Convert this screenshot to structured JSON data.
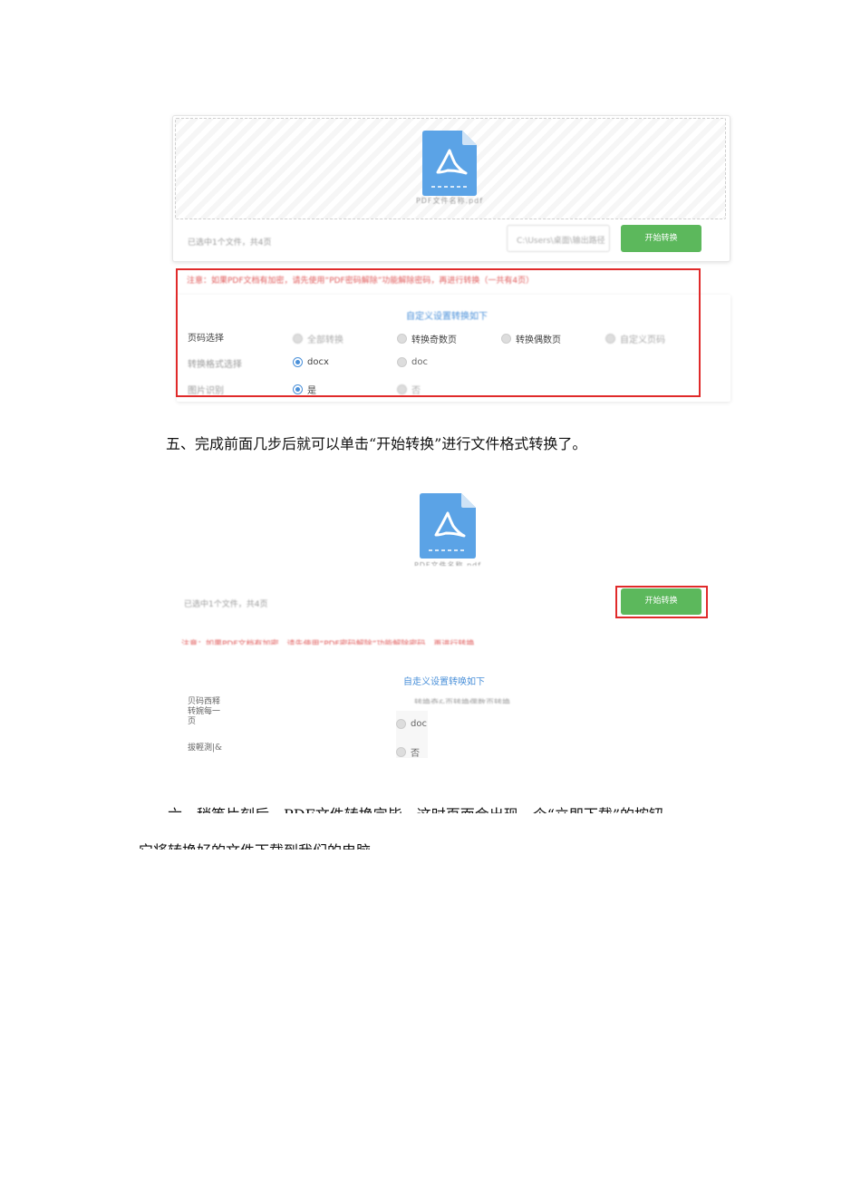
{
  "screenshot1": {
    "file_name": "PDF文件名称.pdf",
    "hint_text": "已选中1个文件，共4页",
    "output_path_placeholder": "C:\\Users\\桌面\\输出路径",
    "start_button": "开始转换",
    "note_text": "注意：如果PDF文档有加密，请先使用“PDF密码解除”功能解除密码，再进行转换（一共有4页）",
    "custom_settings_title": "自定义设置转换如下",
    "rows": {
      "page_select_label": "页码选择",
      "page_options": [
        "全部转换",
        "转换奇数页",
        "转换偶数页",
        "自定义页码"
      ],
      "format_label": "转换格式选择",
      "format_options": [
        "docx",
        "doc"
      ],
      "image_label": "图片识别",
      "image_options": [
        "是",
        "否"
      ]
    }
  },
  "paragraph5": "五、完成前面几步后就可以单击“开始转换”进行文件格式转换了。",
  "screenshot2": {
    "file_name": "PDF文件名称.pdf",
    "hint_text": "已选中1个文件，共4页",
    "start_button": "开始转换",
    "note_text": "注意：如果PDF文档有加密，请先使用“PDF密码解除”功能解除密码，再进行转换",
    "custom_settings_title": "自走义设置转唤如下",
    "page_label": "贝码西释转婉每一页",
    "mode_text": "转换奇&页转换偶数页转换",
    "format_option": "doc",
    "image_label": "拔輕測|&",
    "image_option": "否"
  },
  "paragraph6_line1": "六、稍等片刻后，PDF文件转换完毕，这时页面会出现一个“立即下载”的按钮",
  "paragraph6_line2": "它将转换好的文件下载到我们的电脑",
  "colors": {
    "accent_green": "#5cb85c",
    "highlight_red": "#e02a2a",
    "link_blue": "#4a90d9",
    "file_icon_blue": "#5ba3e6"
  }
}
